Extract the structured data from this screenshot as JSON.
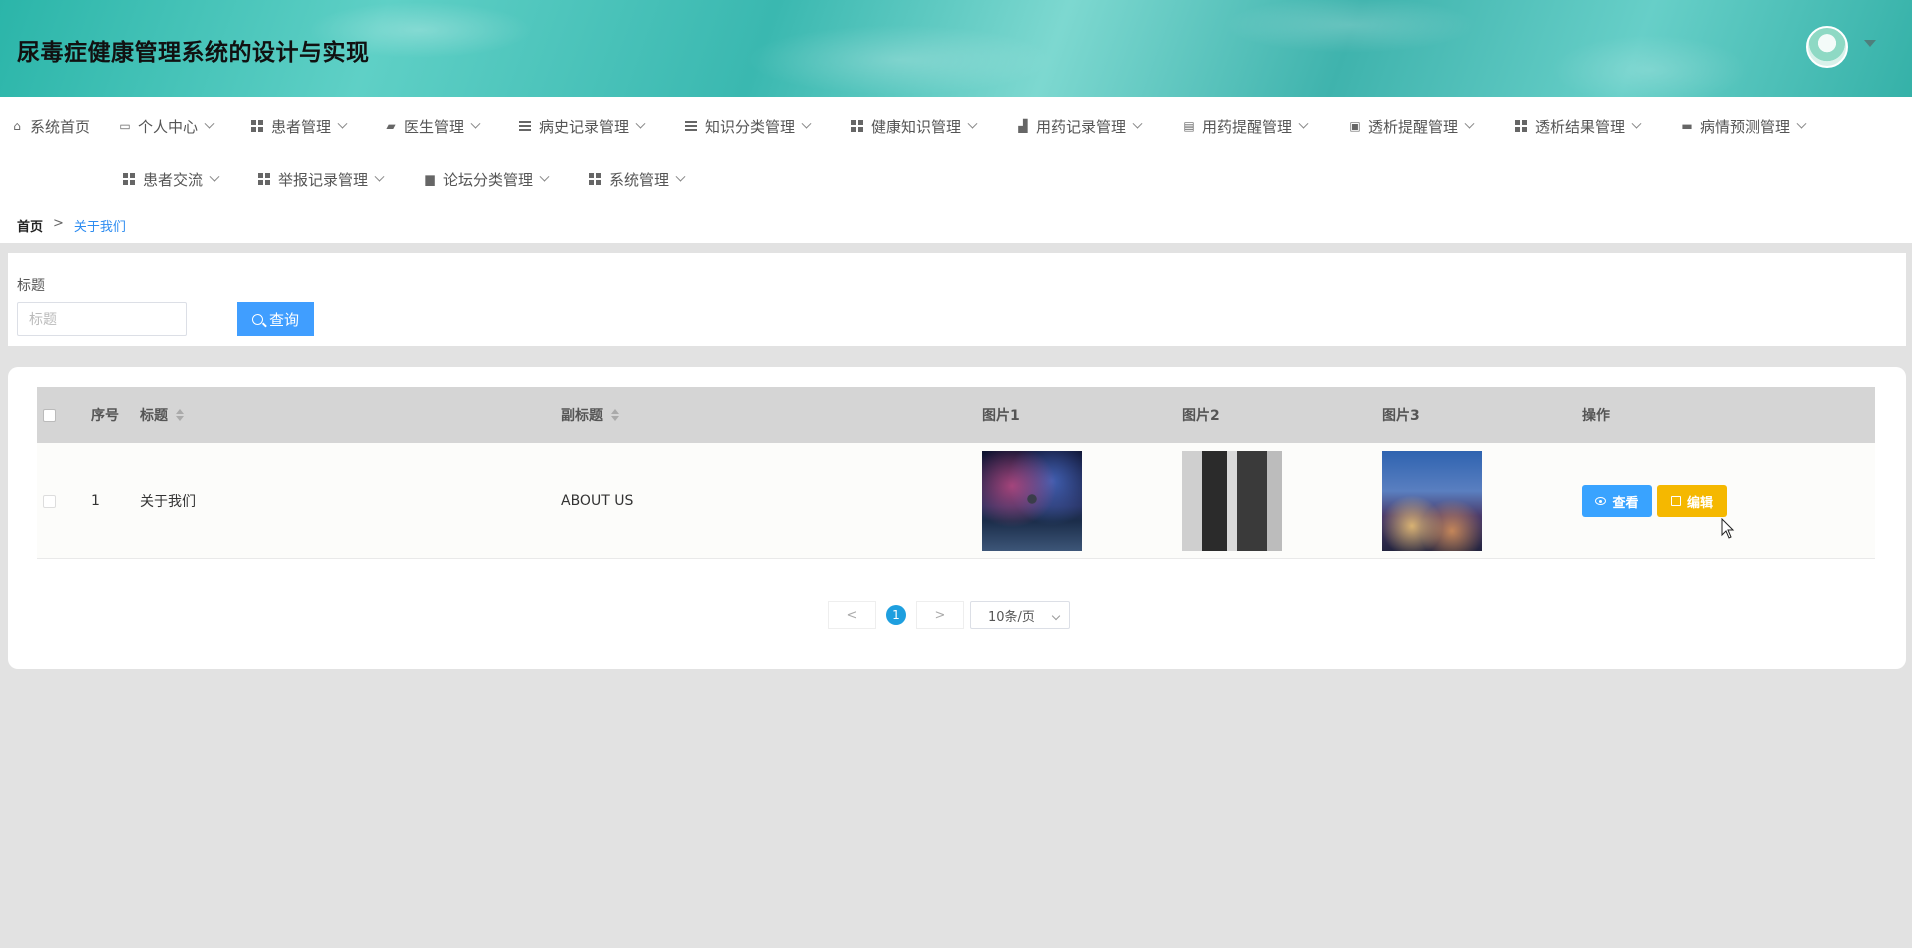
{
  "header": {
    "title": "尿毒症健康管理系统的设计与实现"
  },
  "nav": {
    "items": [
      {
        "label": "系统首页",
        "icon": "home-icon"
      },
      {
        "label": "个人中心",
        "icon": "card-icon"
      },
      {
        "label": "患者管理",
        "icon": "grid-icon"
      },
      {
        "label": "医生管理",
        "icon": "briefcase-icon"
      },
      {
        "label": "病史记录管理",
        "icon": "list-icon"
      },
      {
        "label": "知识分类管理",
        "icon": "list-icon"
      },
      {
        "label": "健康知识管理",
        "icon": "grid-icon"
      },
      {
        "label": "用药记录管理",
        "icon": "thumb-icon"
      },
      {
        "label": "用药提醒管理",
        "icon": "clipboard-icon"
      },
      {
        "label": "透析提醒管理",
        "icon": "clipboard-x-icon"
      },
      {
        "label": "透析结果管理",
        "icon": "grid-icon"
      },
      {
        "label": "病情预测管理",
        "icon": "monitor-icon"
      },
      {
        "label": "患者交流",
        "icon": "grid-icon"
      },
      {
        "label": "举报记录管理",
        "icon": "table-icon"
      },
      {
        "label": "论坛分类管理",
        "icon": "printer-icon"
      },
      {
        "label": "系统管理",
        "icon": "grid-icon"
      }
    ]
  },
  "breadcrumb": {
    "home": "首页",
    "separator": ">",
    "current": "关于我们"
  },
  "search": {
    "label": "标题",
    "placeholder": "标题",
    "button": "查询"
  },
  "table": {
    "headers": {
      "index": "序号",
      "title": "标题",
      "subtitle": "副标题",
      "image1": "图片1",
      "image2": "图片2",
      "image3": "图片3",
      "actions": "操作"
    },
    "rows": [
      {
        "index": "1",
        "title": "关于我们",
        "subtitle": "ABOUT US"
      }
    ],
    "view_button": "查看",
    "edit_button": "编辑"
  },
  "pagination": {
    "prev": "<",
    "current": "1",
    "next": ">",
    "page_size": "10条/页"
  },
  "colors": {
    "primary": "#409eff",
    "view": "#39a3ff",
    "edit": "#f5b800",
    "active_page": "#1e9fdf"
  }
}
